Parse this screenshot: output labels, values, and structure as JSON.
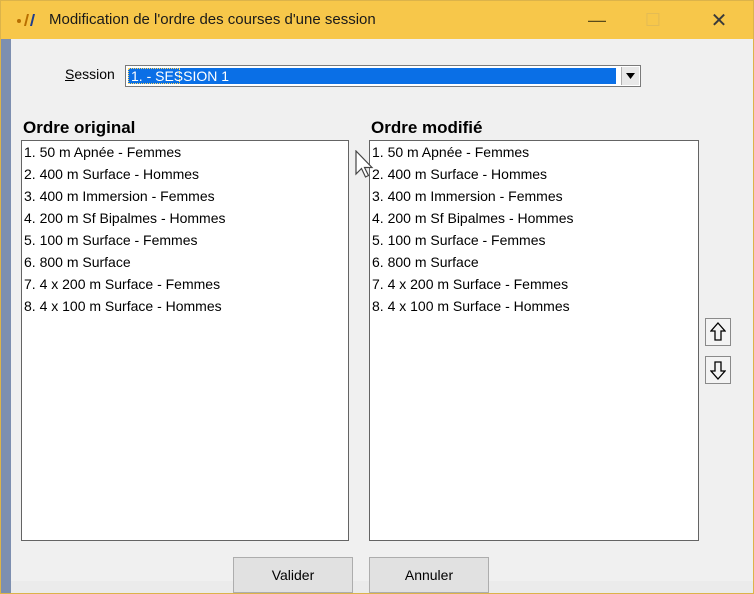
{
  "window": {
    "title": "Modification de l'ordre des courses d'une session",
    "controls": {
      "minimize": "—",
      "maximize": "☐",
      "close": "✕"
    }
  },
  "session": {
    "label_prefix": "",
    "label_access_key": "S",
    "label_rest": "ession",
    "value": "1. - SESSION 1"
  },
  "original_list": {
    "heading": "Ordre original",
    "items": [
      "1. 50 m Apnée  -  Femmes",
      "2. 400 m Surface  -  Hommes",
      "3. 400 m Immersion  -  Femmes",
      "4. 200 m Sf Bipalmes  -  Hommes",
      "5. 100 m Surface  -  Femmes",
      "6. 800 m Surface",
      "7. 4 x 200 m Surface  -  Femmes",
      "8. 4 x 100 m Surface  -  Hommes"
    ]
  },
  "modified_list": {
    "heading": "Ordre modifié",
    "items": [
      "1. 50 m Apnée  -  Femmes",
      "2. 400 m Surface  -  Hommes",
      "3. 400 m Immersion  -  Femmes",
      "4. 200 m Sf Bipalmes  -  Hommes",
      "5. 100 m Surface  -  Femmes",
      "6. 800 m Surface",
      "7. 4 x 200 m Surface  -  Femmes",
      "8. 4 x 100 m Surface  -  Hommes"
    ]
  },
  "buttons": {
    "validate": "Valider",
    "cancel": "Annuler",
    "move_up_icon": "arrow-up-icon",
    "move_down_icon": "arrow-down-icon"
  },
  "colors": {
    "titlebar": "#f7c74a",
    "selection": "#0a6fe6"
  }
}
